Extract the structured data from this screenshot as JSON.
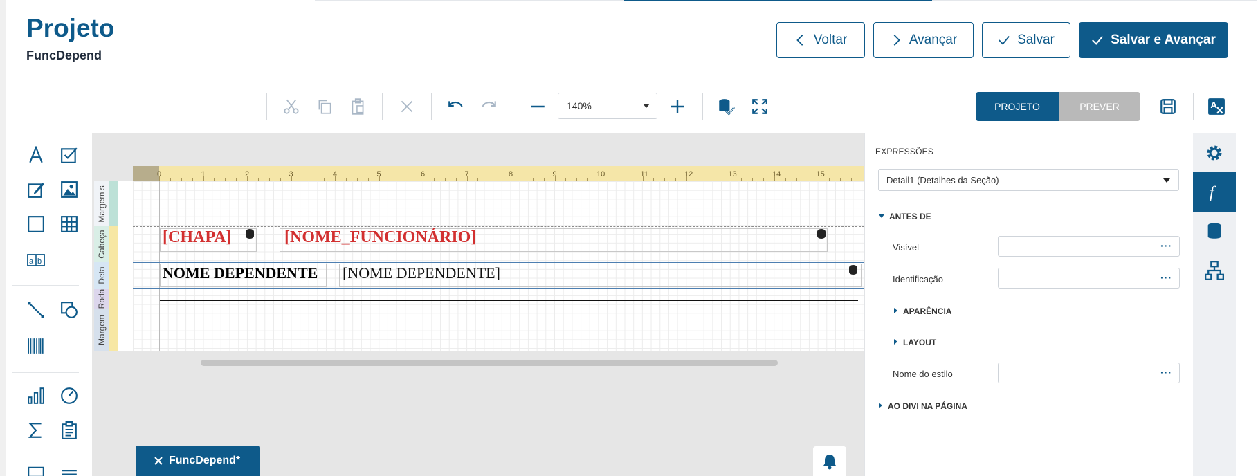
{
  "header": {
    "title": "Projeto",
    "subtitle": "FuncDepend",
    "buttons": {
      "back": "Voltar",
      "next": "Avançar",
      "save": "Salvar",
      "save_next": "Salvar e Avançar"
    }
  },
  "toolbar": {
    "zoom": "140%",
    "mode_design": "PROJETO",
    "mode_preview": "PREVER"
  },
  "ruler": {
    "ticks": [
      "0",
      "1",
      "2",
      "3",
      "4",
      "5",
      "6",
      "7",
      "8",
      "9",
      "10",
      "11",
      "12",
      "13",
      "14",
      "15"
    ]
  },
  "bands": {
    "top_margin": "Margem s",
    "header": "Cabeça",
    "detail": "Deta",
    "footer": "Roda",
    "bottom_margin": "Margem"
  },
  "report": {
    "field_chapa": "[CHAPA]",
    "field_nome_func": "[NOME_FUNCIONÁRIO]",
    "label_dep": "NOME DEPENDENTE",
    "field_dep": "[NOME  DEPENDENTE]"
  },
  "tab": {
    "label": "FuncDepend*"
  },
  "panel": {
    "title": "EXPRESSÕES",
    "selected": "Detail1 (Detalhes da Seção)",
    "sections": {
      "before": "ANTES DE",
      "appearance": "APARÊNCIA",
      "layout": "LAYOUT",
      "page_break": "AO DIVI NA PÁGINA"
    },
    "props": {
      "visible": "Visível",
      "identification": "Identificação",
      "style_name": "Nome do estilo"
    },
    "ellipsis": "···"
  },
  "colors": {
    "brand": "#0e5a8a",
    "field_red": "#d23030",
    "ruler": "#f5e6a8"
  }
}
